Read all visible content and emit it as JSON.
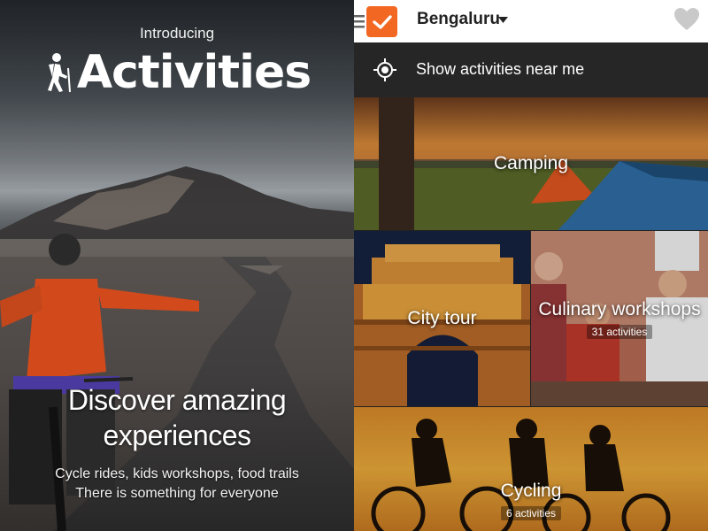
{
  "left_panel": {
    "intro": "Introducing",
    "title": "Activities",
    "headline_line1": "Discover amazing",
    "headline_line2": "experiences",
    "subtitle_line1": "Cycle rides, kids workshops, food trails",
    "subtitle_line2": "There is something for everyone",
    "icon": "hiker-icon"
  },
  "app_bar": {
    "city": "Bengaluru",
    "icons": [
      "menu-icon",
      "app-logo-check-icon",
      "chevron-down-icon",
      "heart-icon"
    ],
    "brand_color": "#f26722"
  },
  "near_me": {
    "label": "Show activities near me",
    "icon": "location-target-icon"
  },
  "tiles": [
    {
      "label": "Camping"
    },
    {
      "label": "City tour"
    },
    {
      "label": "Culinary workshops",
      "count": "31 activities"
    },
    {
      "label": "Cycling",
      "count": "6 activities"
    }
  ]
}
